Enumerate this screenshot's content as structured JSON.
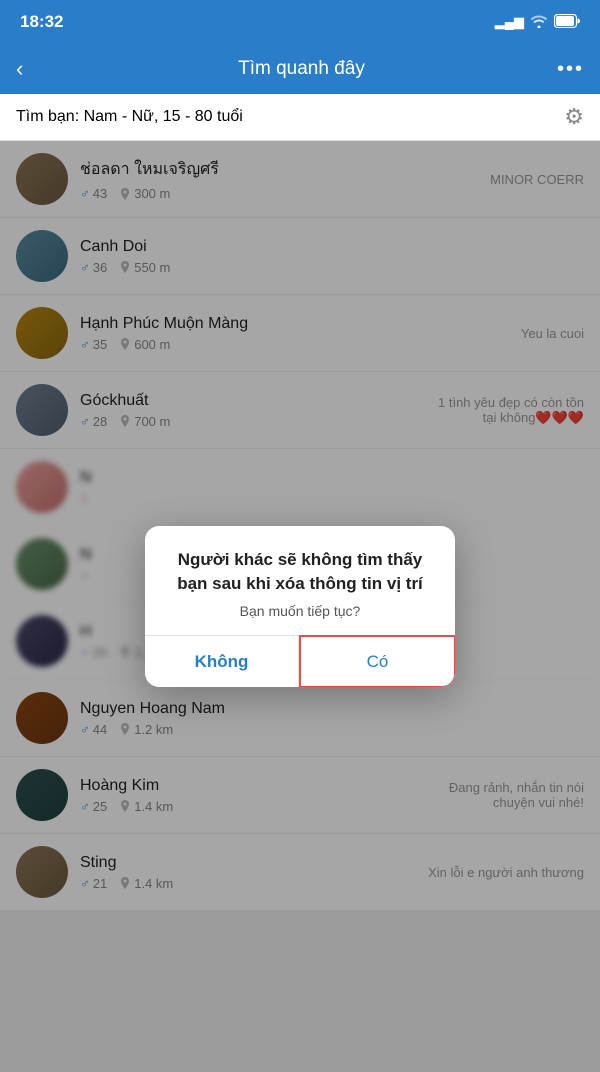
{
  "statusBar": {
    "time": "18:32",
    "signal": "▂▄",
    "wifi": "WiFi",
    "battery": "Battery"
  },
  "header": {
    "backLabel": "‹",
    "title": "Tìm quanh đây",
    "moreLabel": "•••"
  },
  "filterBar": {
    "label": "Tìm bạn:",
    "value": "Nam - Nữ, 15 - 80 tuổi"
  },
  "users": [
    {
      "name": "ช่อลดา ใหมเจริญศรี",
      "gender": "male",
      "age": "43",
      "distance": "300 m",
      "status": "MINOR  COERR",
      "avatarClass": "avatar-1"
    },
    {
      "name": "Canh Doi",
      "gender": "male",
      "age": "36",
      "distance": "550 m",
      "status": "",
      "avatarClass": "avatar-2"
    },
    {
      "name": "Hạnh Phúc Muộn Màng",
      "gender": "male",
      "age": "35",
      "distance": "600 m",
      "status": "Yeu la cuoi",
      "avatarClass": "avatar-3"
    },
    {
      "name": "Góckhuất",
      "gender": "male",
      "age": "28",
      "distance": "700 m",
      "status": "1 tình yêu đẹp có còn tồn tại không❤️❤️❤️",
      "avatarClass": "avatar-4"
    },
    {
      "name": "N",
      "gender": "female",
      "age": "",
      "distance": "",
      "status": "",
      "avatarClass": "avatar-5",
      "blurred": true
    },
    {
      "name": "N",
      "gender": "male",
      "age": "",
      "distance": "",
      "status": "",
      "avatarClass": "avatar-6",
      "blurred": true
    },
    {
      "name": "H",
      "gender": "male",
      "age": "25",
      "distance": "1.2 km",
      "status": "",
      "avatarClass": "avatar-7",
      "blurred": true
    },
    {
      "name": "Nguyen Hoang Nam",
      "gender": "male",
      "age": "44",
      "distance": "1.2 km",
      "status": "",
      "avatarClass": "avatar-8"
    },
    {
      "name": "Hoàng Kim",
      "gender": "male",
      "age": "25",
      "distance": "1.4 km",
      "status": "Đang rảnh, nhắn tin nói chuyện vui nhé!",
      "avatarClass": "avatar-9"
    },
    {
      "name": "Sting",
      "gender": "male",
      "age": "21",
      "distance": "1.4 km",
      "status": "Xin lỗi e người anh thương",
      "avatarClass": "avatar-1"
    }
  ],
  "modal": {
    "title": "Người khác sẽ không tìm thấy bạn sau khi xóa thông tin vị trí",
    "subtitle": "Bạn muốn tiếp tục?",
    "cancelLabel": "Không",
    "confirmLabel": "Có"
  }
}
